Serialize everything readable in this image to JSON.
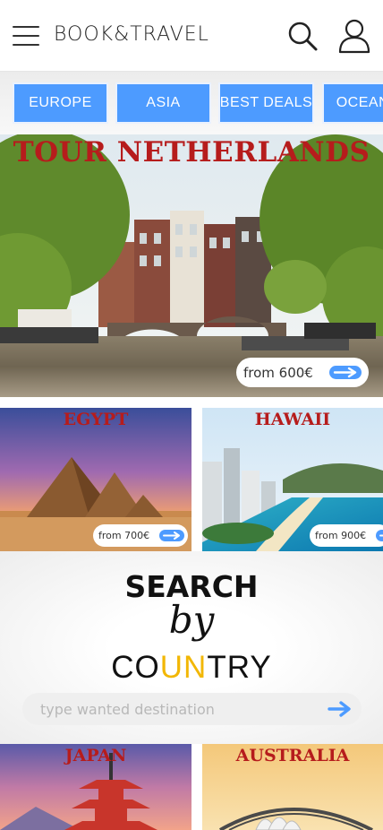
{
  "header": {
    "brand": "BOOK&TRAVEL"
  },
  "tabs": [
    {
      "label": "EUROPE"
    },
    {
      "label": "ASIA"
    },
    {
      "label": "BEST DEALS"
    },
    {
      "label": "OCEANIA"
    }
  ],
  "hero": {
    "title": "TOUR NETHERLANDS",
    "price": "from 600€"
  },
  "cards": [
    {
      "title": "EGYPT",
      "price": "from 700€"
    },
    {
      "title": "HAWAII",
      "price": "from 900€"
    }
  ],
  "search": {
    "line1": "SEARCH",
    "line2": "by",
    "line3_a": "CO",
    "line3_b": "UN",
    "line3_c": "TRY",
    "placeholder": "type wanted destination"
  },
  "bottom_cards": [
    {
      "title": "JAPAN"
    },
    {
      "title": "AUSTRALIA"
    }
  ],
  "colors": {
    "accent": "#4d9bff",
    "title_red": "#b61c1c",
    "country_yellow": "#f2b705"
  }
}
